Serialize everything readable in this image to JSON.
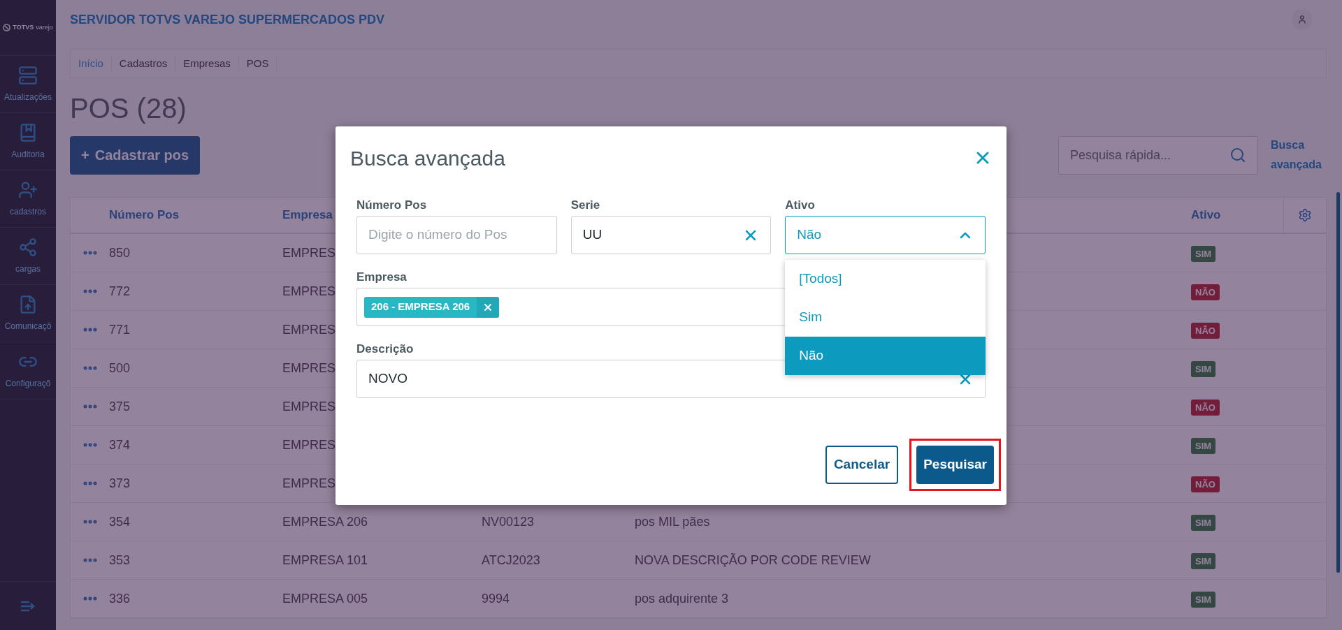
{
  "app": {
    "logo": "TOTVS",
    "logo_sub": "varejo",
    "title": "SERVIDOR TOTVS VAREJO SUPERMERCADOS PDV"
  },
  "sidebar": {
    "items": [
      {
        "label": "Atualizações"
      },
      {
        "label": "Auditoria"
      },
      {
        "label": "cadastros"
      },
      {
        "label": "cargas"
      },
      {
        "label": "Comunicaçõ"
      },
      {
        "label": "Configuraçõ"
      }
    ]
  },
  "breadcrumb": [
    {
      "label": "Início",
      "link": true
    },
    {
      "label": "Cadastros",
      "link": false
    },
    {
      "label": "Empresas",
      "link": false
    },
    {
      "label": "POS",
      "link": false
    }
  ],
  "page": {
    "title": "POS (28)",
    "add_button": {
      "icon": "+",
      "label": "Cadastrar pos"
    },
    "search": {
      "placeholder": "Pesquisa rápida..."
    },
    "advanced_link": "Busca avançada"
  },
  "table": {
    "columns": [
      "Número Pos",
      "Empresa",
      "Ativo"
    ],
    "rows": [
      {
        "number": "850",
        "company": "EMPRES",
        "status": "SIM",
        "active": true
      },
      {
        "number": "772",
        "company": "EMPRES",
        "status": "NÃO",
        "active": false
      },
      {
        "number": "771",
        "company": "EMPRES",
        "status": "NÃO",
        "active": false
      },
      {
        "number": "500",
        "company": "EMPRES",
        "status": "SIM",
        "active": true
      },
      {
        "number": "375",
        "company": "EMPRES",
        "status": "NÃO",
        "active": false
      },
      {
        "number": "374",
        "company": "EMPRES",
        "status": "SIM",
        "active": true
      },
      {
        "number": "373",
        "company": "EMPRES",
        "status": "NÃO",
        "active": false
      },
      {
        "number": "354",
        "company": "EMPRESA 206",
        "column_3": "NV00123",
        "column_4": "pos MIL pães",
        "status": "SIM",
        "active": true
      },
      {
        "number": "353",
        "company": "EMPRESA 101",
        "column_3": "ATCJ2023",
        "column_4": "NOVA DESCRIÇÃO POR CODE REVIEW",
        "status": "SIM",
        "active": true
      },
      {
        "number": "336",
        "company": "EMPRESA 005",
        "column_3": "9994",
        "column_4": "pos adquirente 3",
        "status": "SIM",
        "active": true
      }
    ]
  },
  "modal": {
    "title": "Busca avançada",
    "fields": [
      {
        "kind": "text",
        "label": "Número Pos",
        "placeholder": "Digite o número do Pos"
      },
      {
        "kind": "text",
        "label": "Serie",
        "value": "UU",
        "clearable": true
      },
      {
        "kind": "select",
        "label": "Ativo",
        "value": "Não",
        "expanded": true,
        "options": [
          {
            "label": "[Todos]",
            "selected": false
          },
          {
            "label": "Sim",
            "selected": false
          },
          {
            "label": "Não",
            "selected": true
          }
        ]
      },
      {
        "kind": "tags",
        "label": "Empresa",
        "tags": [
          "206 - EMPRESA 206"
        ]
      },
      {
        "kind": "text",
        "label": "Descrição",
        "value": "NOVO",
        "clearable": true
      }
    ],
    "buttons": [
      {
        "label": "Cancelar",
        "kind": "secondary",
        "highlighted": false
      },
      {
        "label": "Pesquisar",
        "kind": "primary",
        "highlighted": true
      }
    ]
  }
}
